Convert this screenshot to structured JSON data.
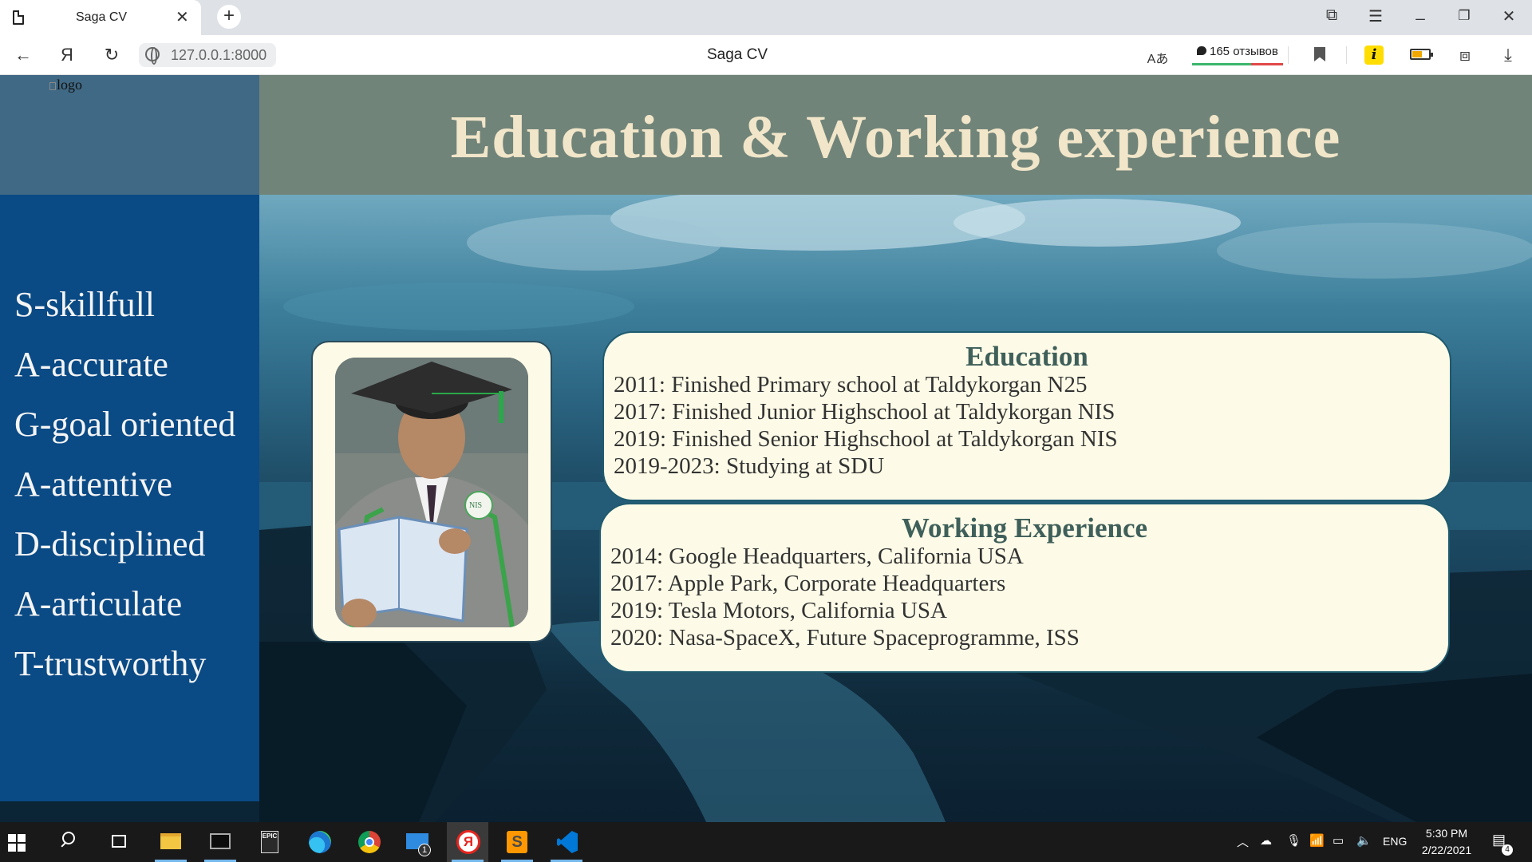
{
  "browser": {
    "tab_title": "Saga CV",
    "new_tab_symbol": "+",
    "url": "127.0.0.1:8000",
    "page_title": "Saga CV",
    "reviews": "165 отзывов",
    "yandex_icon": "Я",
    "extension_label": "i"
  },
  "page": {
    "logo_alt": "logo",
    "heading": "Education & Working experience",
    "acronym": [
      "S-skillfull",
      "A-accurate",
      "G-goal oriented",
      "A-attentive",
      "D-disciplined",
      "A-articulate",
      "T-trustworthy"
    ],
    "education": {
      "title": "Education",
      "items": [
        "2011: Finished Primary school at Taldykorgan N25",
        "2017: Finished Junior Highschool at Taldykorgan NIS",
        "2019: Finished Senior Highschool at Taldykorgan NIS",
        "2019-2023: Studying at SDU"
      ]
    },
    "work": {
      "title": "Working Experience",
      "items": [
        "2014: Google Headquarters, California USA",
        "2017: Apple Park, Corporate Headquarters",
        "2019: Tesla Motors, California USA",
        "2020: Nasa-SpaceX, Future Spaceprogramme, ISS"
      ]
    },
    "badge_text": "NIS"
  },
  "taskbar": {
    "language": "ENG",
    "time": "5:30 PM",
    "date": "2/22/2021",
    "notification_count": "4",
    "mail_badge": "1",
    "epic_label": "EPIC"
  },
  "colors": {
    "sidebar": "#0a4a85",
    "sidebar_top": "#406985",
    "header_band": "#718479",
    "heading_text": "#f1e6c9",
    "box_bg": "#fdfbe7",
    "box_title": "#3f5f5a"
  }
}
